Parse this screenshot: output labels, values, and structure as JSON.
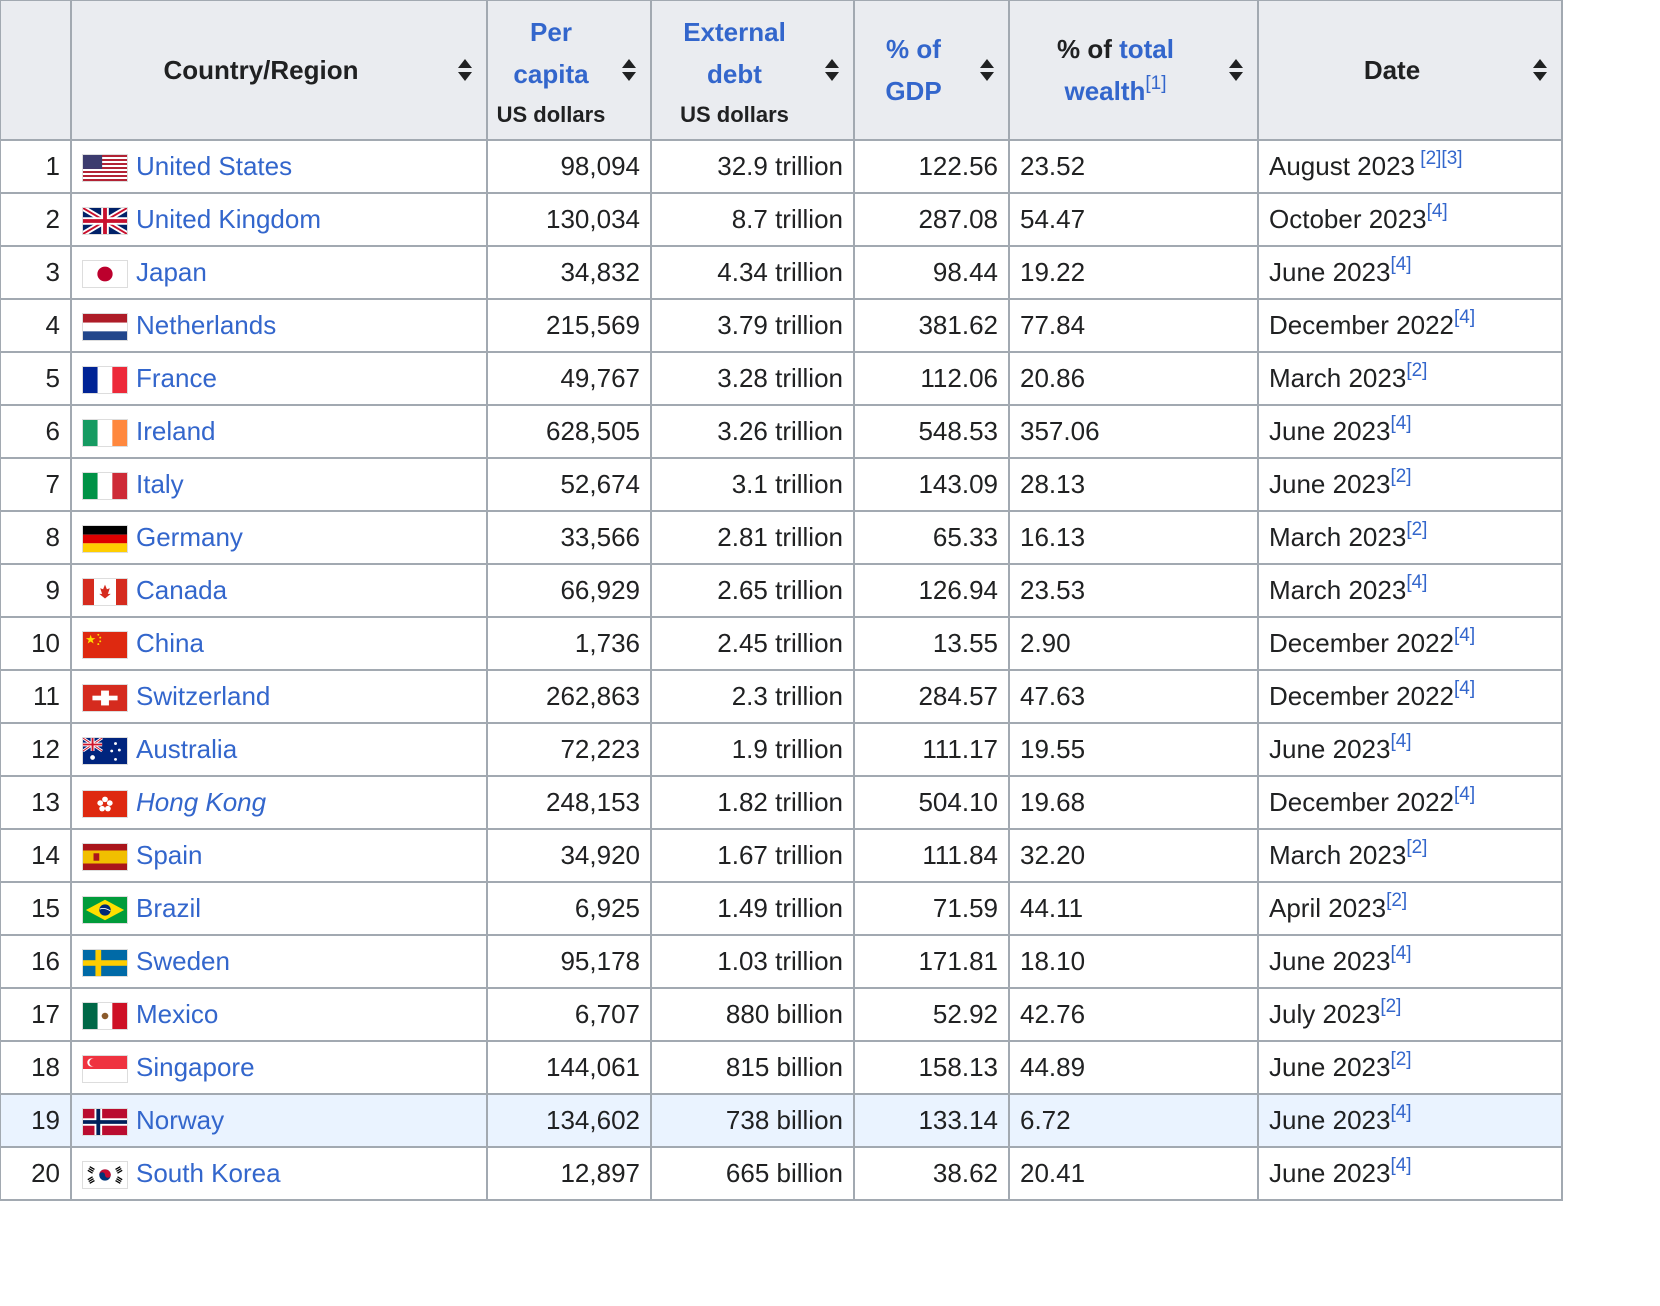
{
  "headers": {
    "rank": "",
    "country": "Country/Region",
    "per_capita_link": "Per capita",
    "per_capita_sub": "US dollars",
    "external_debt_link": "External debt",
    "external_debt_sub": "US dollars",
    "pct_gdp_link": "% of GDP",
    "pct_wealth_prefix": "% of",
    "pct_wealth_link": "total wealth",
    "pct_wealth_ref": "[1]",
    "date": "Date"
  },
  "rows": [
    {
      "rank": "1",
      "country": "United States",
      "flag": "us-flag-icon",
      "per_capita": "98,094",
      "debt": "32.9 trillion",
      "gdp": "122.56",
      "wealth": "23.52",
      "date": "August 2023",
      "refs": " [2][3]"
    },
    {
      "rank": "2",
      "country": "United Kingdom",
      "flag": "uk-flag-icon",
      "per_capita": "130,034",
      "debt": "8.7 trillion",
      "gdp": "287.08",
      "wealth": "54.47",
      "date": "October 2023",
      "refs": "[4]"
    },
    {
      "rank": "3",
      "country": "Japan",
      "flag": "japan-flag-icon",
      "per_capita": "34,832",
      "debt": "4.34 trillion",
      "gdp": "98.44",
      "wealth": "19.22",
      "date": "June 2023",
      "refs": "[4]"
    },
    {
      "rank": "4",
      "country": "Netherlands",
      "flag": "netherlands-flag-icon",
      "per_capita": "215,569",
      "debt": "3.79 trillion",
      "gdp": "381.62",
      "wealth": "77.84",
      "date": "December 2022",
      "refs": "[4]"
    },
    {
      "rank": "5",
      "country": "France",
      "flag": "france-flag-icon",
      "per_capita": "49,767",
      "debt": "3.28 trillion",
      "gdp": "112.06",
      "wealth": "20.86",
      "date": "March 2023",
      "refs": "[2]"
    },
    {
      "rank": "6",
      "country": "Ireland",
      "flag": "ireland-flag-icon",
      "per_capita": "628,505",
      "debt": "3.26 trillion",
      "gdp": "548.53",
      "wealth": "357.06",
      "date": "June 2023",
      "refs": "[4]"
    },
    {
      "rank": "7",
      "country": "Italy",
      "flag": "italy-flag-icon",
      "per_capita": "52,674",
      "debt": "3.1 trillion",
      "gdp": "143.09",
      "wealth": "28.13",
      "date": "June 2023",
      "refs": "[2]"
    },
    {
      "rank": "8",
      "country": "Germany",
      "flag": "germany-flag-icon",
      "per_capita": "33,566",
      "debt": "2.81 trillion",
      "gdp": "65.33",
      "wealth": "16.13",
      "date": "March 2023",
      "refs": "[2]"
    },
    {
      "rank": "9",
      "country": "Canada",
      "flag": "canada-flag-icon",
      "per_capita": "66,929",
      "debt": "2.65 trillion",
      "gdp": "126.94",
      "wealth": "23.53",
      "date": "March 2023",
      "refs": "[4]"
    },
    {
      "rank": "10",
      "country": "China",
      "flag": "china-flag-icon",
      "per_capita": "1,736",
      "debt": "2.45 trillion",
      "gdp": "13.55",
      "wealth": "2.90",
      "date": "December 2022",
      "refs": "[4]"
    },
    {
      "rank": "11",
      "country": "Switzerland",
      "flag": "switzerland-flag-icon",
      "per_capita": "262,863",
      "debt": "2.3 trillion",
      "gdp": "284.57",
      "wealth": "47.63",
      "date": "December 2022",
      "refs": "[4]"
    },
    {
      "rank": "12",
      "country": "Australia",
      "flag": "australia-flag-icon",
      "per_capita": "72,223",
      "debt": "1.9 trillion",
      "gdp": "111.17",
      "wealth": "19.55",
      "date": "June 2023",
      "refs": "[4]"
    },
    {
      "rank": "13",
      "country": "Hong Kong",
      "flag": "hong-kong-flag-icon",
      "per_capita": "248,153",
      "debt": "1.82 trillion",
      "gdp": "504.10",
      "wealth": "19.68",
      "date": "December 2022",
      "refs": "[4]",
      "italic": true
    },
    {
      "rank": "14",
      "country": "Spain",
      "flag": "spain-flag-icon",
      "per_capita": "34,920",
      "debt": "1.67 trillion",
      "gdp": "111.84",
      "wealth": "32.20",
      "date": "March 2023",
      "refs": "[2]"
    },
    {
      "rank": "15",
      "country": "Brazil",
      "flag": "brazil-flag-icon",
      "per_capita": "6,925",
      "debt": "1.49 trillion",
      "gdp": "71.59",
      "wealth": "44.11",
      "date": "April 2023",
      "refs": "[2]"
    },
    {
      "rank": "16",
      "country": "Sweden",
      "flag": "sweden-flag-icon",
      "per_capita": "95,178",
      "debt": "1.03 trillion",
      "gdp": "171.81",
      "wealth": "18.10",
      "date": "June 2023",
      "refs": "[4]"
    },
    {
      "rank": "17",
      "country": "Mexico",
      "flag": "mexico-flag-icon",
      "per_capita": "6,707",
      "debt": "880 billion",
      "gdp": "52.92",
      "wealth": "42.76",
      "date": "July 2023",
      "refs": "[2]"
    },
    {
      "rank": "18",
      "country": "Singapore",
      "flag": "singapore-flag-icon",
      "per_capita": "144,061",
      "debt": "815 billion",
      "gdp": "158.13",
      "wealth": "44.89",
      "date": "June 2023",
      "refs": "[2]"
    },
    {
      "rank": "19",
      "country": "Norway",
      "flag": "norway-flag-icon",
      "per_capita": "134,602",
      "debt": "738 billion",
      "gdp": "133.14",
      "wealth": "6.72",
      "date": "June 2023",
      "refs": "[4]",
      "highlight": true
    },
    {
      "rank": "20",
      "country": "South Korea",
      "flag": "south-korea-flag-icon",
      "per_capita": "12,897",
      "debt": "665 billion",
      "gdp": "38.62",
      "wealth": "20.41",
      "date": "June 2023",
      "refs": "[4]"
    }
  ]
}
